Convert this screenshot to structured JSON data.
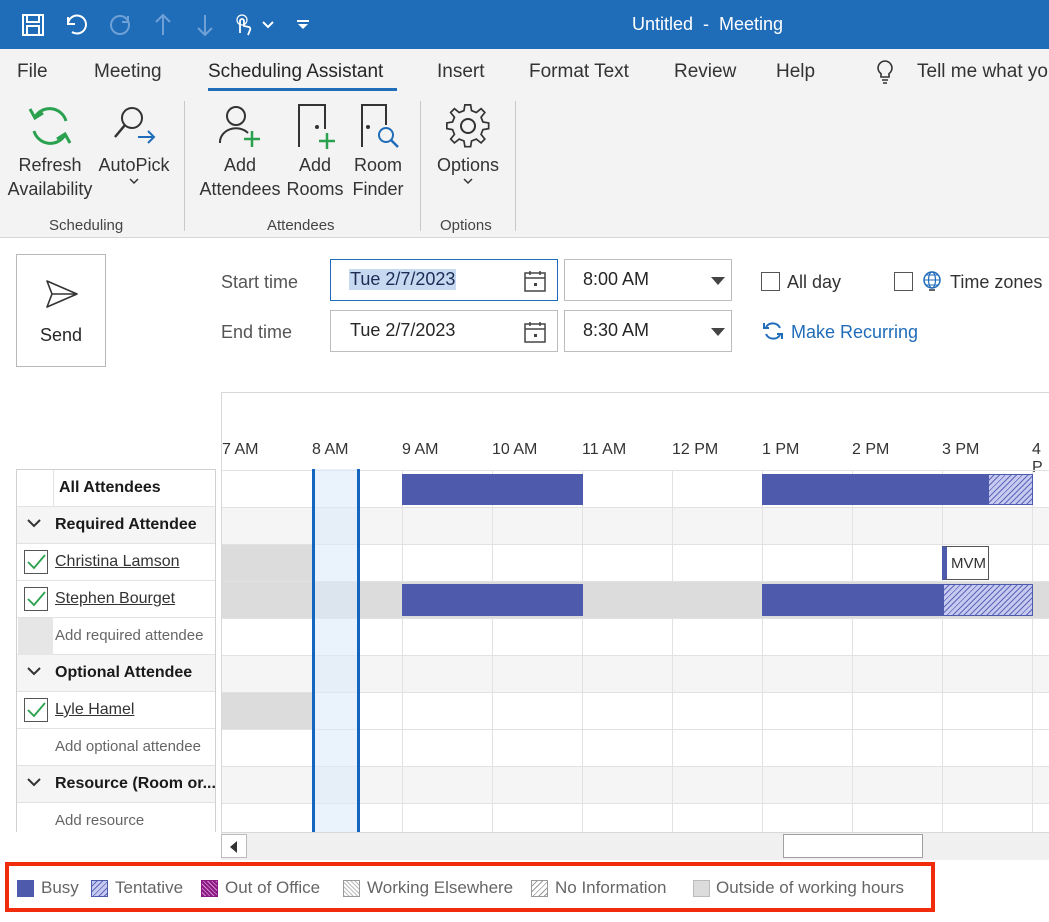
{
  "window": {
    "title": "Untitled  -  Meeting"
  },
  "tabs": [
    {
      "label": "File"
    },
    {
      "label": "Meeting"
    },
    {
      "label": "Scheduling Assistant"
    },
    {
      "label": "Insert"
    },
    {
      "label": "Format Text"
    },
    {
      "label": "Review"
    },
    {
      "label": "Help"
    }
  ],
  "tell_me": "Tell me what yo",
  "ribbon": {
    "refresh": [
      "Refresh",
      "Availability"
    ],
    "autopick": "AutoPick",
    "scheduling_group": "Scheduling",
    "add_attendees": [
      "Add",
      "Attendees"
    ],
    "add_rooms": [
      "Add",
      "Rooms"
    ],
    "room_finder": [
      "Room",
      "Finder"
    ],
    "attendees_group": "Attendees",
    "options": "Options",
    "options_group": "Options"
  },
  "form": {
    "send": "Send",
    "start_label": "Start time",
    "end_label": "End time",
    "start_date": "Tue 2/7/2023",
    "end_date": "Tue 2/7/2023",
    "start_time": "8:00 AM",
    "end_time": "8:30 AM",
    "all_day": "All day",
    "time_zones": "Time zones",
    "make_recurring": "Make Recurring"
  },
  "grid": {
    "hours": [
      "7 AM",
      "8 AM",
      "9 AM",
      "10 AM",
      "11 AM",
      "12 PM",
      "1 PM",
      "2 PM",
      "3 PM",
      "4 P"
    ],
    "mvm_label": "MVM"
  },
  "attendees": {
    "all": "All Attendees",
    "required_header": "Required Attendee",
    "required": [
      "Christina Lamson",
      "Stephen Bourget"
    ],
    "add_required": "Add required attendee",
    "optional_header": "Optional Attendee",
    "optional": [
      "Lyle Hamel"
    ],
    "add_optional": "Add optional attendee",
    "resource_header": "Resource (Room or...",
    "add_resource": "Add resource"
  },
  "legend": {
    "busy": "Busy",
    "tentative": "Tentative",
    "out_of_office": "Out of Office",
    "working_elsewhere": "Working Elsewhere",
    "no_information": "No Information",
    "outside_hours": "Outside of working hours",
    "colors": {
      "busy": "#4e5aab",
      "oof": "#8a1a82",
      "accent": "#1f6cb9",
      "highlight_border": "#f02c0c"
    }
  }
}
